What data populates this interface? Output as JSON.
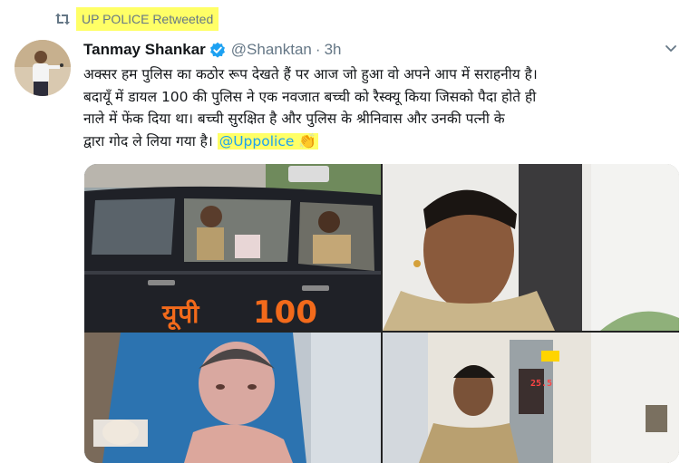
{
  "retweet": {
    "label": "UP POLICE Retweeted",
    "icon": "retweet-icon"
  },
  "tweet": {
    "author_name": "Tanmay Shankar",
    "author_handle": "@Shanktan",
    "separator": "·",
    "time": "3h",
    "verified_icon": "verified-badge-icon",
    "menu_icon": "chevron-down-icon",
    "text_lines": [
      "अक्सर हम पुलिस का कठोर रूप देखते हैं पर आज जो हुआ वो अपने आप में सराहनीय है।",
      "बदायूँ में डायल 100 की पुलिस ने एक नवजात बच्ची को रैस्क्यू किया जिसको पैदा होते ही",
      "नाले में फेंक दिया था। बच्ची सुरक्षित है और पुलिस के श्रीनिवास और उनकी पत्नी के",
      "द्वारा गोद ले लिया गया है।"
    ],
    "mention": "@Uppolice",
    "emoji": "👏"
  },
  "media": {
    "car_brand": "यूपी",
    "car_number": "100",
    "machine_readout": "25.5"
  },
  "colors": {
    "highlight": "#ffff66",
    "link": "#1da1f2",
    "muted": "#657786",
    "verified": "#1da1f2",
    "car_text": "#f26a1b"
  }
}
